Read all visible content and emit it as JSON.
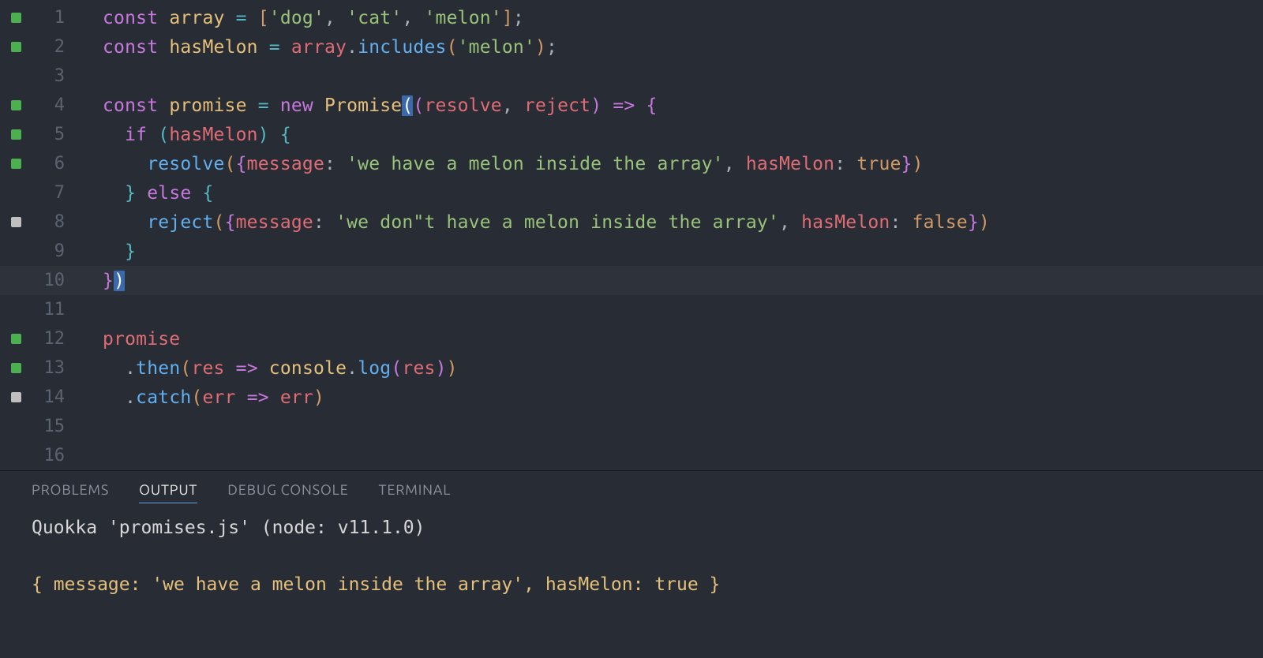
{
  "lines": [
    {
      "num": "1",
      "marker": "green"
    },
    {
      "num": "2",
      "marker": "green"
    },
    {
      "num": "3",
      "marker": ""
    },
    {
      "num": "4",
      "marker": "green"
    },
    {
      "num": "5",
      "marker": "green"
    },
    {
      "num": "6",
      "marker": "green"
    },
    {
      "num": "7",
      "marker": ""
    },
    {
      "num": "8",
      "marker": "gray"
    },
    {
      "num": "9",
      "marker": ""
    },
    {
      "num": "10",
      "marker": "",
      "current": true
    },
    {
      "num": "11",
      "marker": ""
    },
    {
      "num": "12",
      "marker": "green"
    },
    {
      "num": "13",
      "marker": "green"
    },
    {
      "num": "14",
      "marker": "gray"
    },
    {
      "num": "15",
      "marker": ""
    },
    {
      "num": "16",
      "marker": ""
    }
  ],
  "tok": {
    "const": "const",
    "array": "array",
    "eq": " = ",
    "arr_open": "[",
    "arr_close": "]",
    "dog": "'dog'",
    "cat": "'cat'",
    "melon": "'melon'",
    "comma": ", ",
    "semi": ";",
    "hasMelon": "hasMelon",
    "includes": "includes",
    "melon2": "'melon'",
    "promise": "promise",
    "new": "new ",
    "Promise": "Promise",
    "resolve": "resolve",
    "reject": "reject",
    "arrow": " => ",
    "lbrace": "{",
    "rbrace": "}",
    "if": "if",
    "lparen": "(",
    "rparen": ")",
    "msg": "message",
    "colon": ": ",
    "haveStr": "'we have a melon inside the array'",
    "dontStr": "'we don\"t have a melon inside the array'",
    "true": "true",
    "false": "false",
    "else": "else",
    "then": "then",
    "catch": "catch",
    "res": "res",
    "err": "err",
    "console": "console",
    "log": "log",
    "dot": "."
  },
  "panel": {
    "tabs": {
      "problems": "PROBLEMS",
      "output": "OUTPUT",
      "debug": "DEBUG CONSOLE",
      "terminal": "TERMINAL"
    },
    "header": "Quokka 'promises.js' (node: v11.1.0)",
    "output_line": "{ message: 'we have a melon inside the array', hasMelon: true }"
  }
}
